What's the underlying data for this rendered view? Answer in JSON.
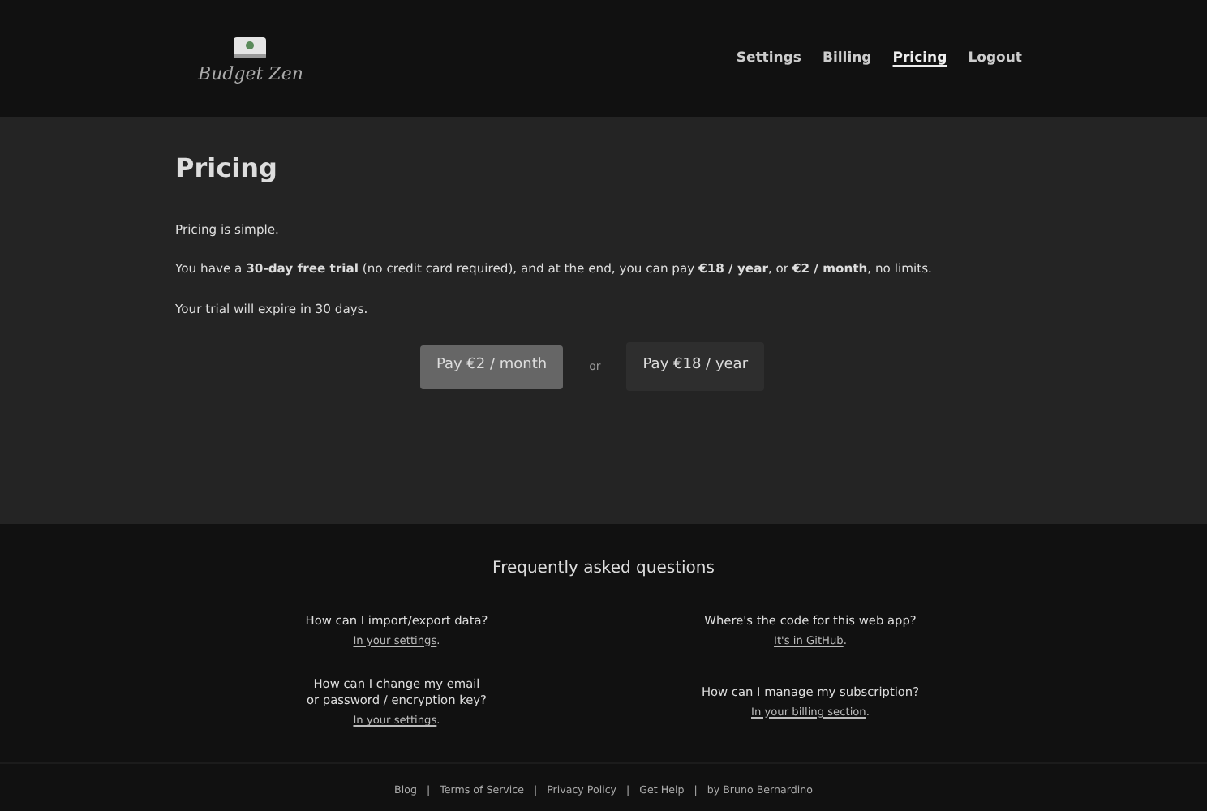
{
  "header": {
    "logo_text": "Budget Zen",
    "nav": [
      {
        "label": "Settings",
        "selected": false
      },
      {
        "label": "Billing",
        "selected": false
      },
      {
        "label": "Pricing",
        "selected": true
      },
      {
        "label": "Logout",
        "selected": false
      }
    ]
  },
  "main": {
    "title": "Pricing",
    "paragraphs": [
      "Pricing is simple.",
      "You have a **30-day free trial** (no credit card required), and at the end, you can pay **€18 / year**, or **€2 / month**, no limits.",
      "Your trial will expire in 30 days."
    ],
    "buttons": [
      {
        "label": "Pay €2 / month",
        "selected": true
      },
      {
        "label": "Pay €18 / year",
        "selected": false
      }
    ],
    "or_text": "or"
  },
  "faq": {
    "title": "Frequently asked questions",
    "items": [
      {
        "question": "How can I import/export data?",
        "link": "In your settings",
        "suffix": "."
      },
      {
        "question": "Where's the code for this web app?",
        "link": "It's in GitHub",
        "suffix": "."
      },
      {
        "question": "How can I change my email\nor password / encryption key?",
        "link": "In your settings",
        "suffix": "."
      },
      {
        "question": "How can I manage my subscription?",
        "link": "In your billing section",
        "suffix": "."
      }
    ]
  },
  "footer": {
    "separator": "|",
    "links": [
      "Blog",
      "Terms of Service",
      "Privacy Policy",
      "Get Help",
      "by Bruno Bernardino"
    ]
  }
}
